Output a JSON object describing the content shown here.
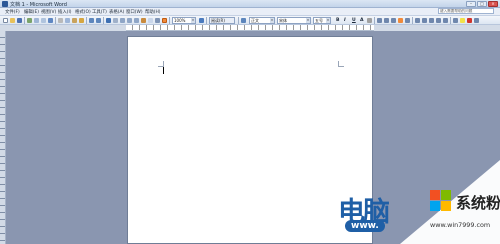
{
  "window": {
    "title": "文档 1 - Microsoft Word"
  },
  "menu": {
    "items": [
      "文件(F)",
      "编辑(E)",
      "视图(V)",
      "插入(I)",
      "格式(O)",
      "工具(T)",
      "表格(A)",
      "窗口(W)",
      "帮助(H)"
    ]
  },
  "help_search": {
    "placeholder": "键入需要帮助的问题"
  },
  "toolbar": {
    "zoom": "100%",
    "read_label": "阅读(R)",
    "style": "正文",
    "font": "宋体",
    "size": "五号",
    "bold": "B",
    "italic": "I",
    "underline": "U",
    "highlight": "A"
  },
  "watermark": {
    "text": "电脑",
    "url": "www.",
    "brand": "系统粉",
    "site": "www.win7999.com",
    "colors": {
      "blue": "#1f5fa6",
      "red": "#f25022",
      "green": "#7fba00",
      "lightblue": "#00a4ef",
      "yellow": "#ffb900"
    }
  }
}
